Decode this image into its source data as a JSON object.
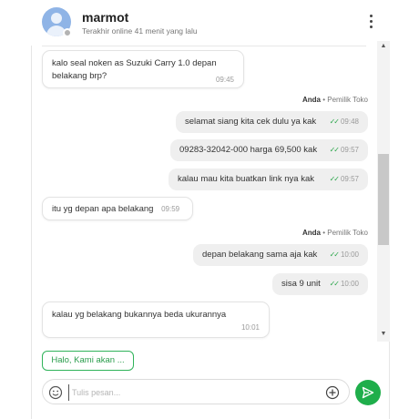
{
  "header": {
    "name": "marmot",
    "last_seen": "Terakhir online 41 menit yang lalu"
  },
  "messages": [
    {
      "direction": "in",
      "text_line1": "kalo seal noken as Suzuki Carry 1.0 depan",
      "text_line2": "belakang brp?",
      "time": "09:45"
    },
    {
      "direction": "sender",
      "sender_name": "Anda",
      "sender_role": "• Pemilik Toko"
    },
    {
      "direction": "out",
      "text": "selamat siang kita cek dulu ya kak",
      "time": "09:48",
      "ticks": "✓✓"
    },
    {
      "direction": "out",
      "text": "09283-32042-000 harga 69,500 kak",
      "time": "09:57",
      "ticks": "✓✓"
    },
    {
      "direction": "out",
      "text": "kalau mau kita buatkan link nya kak",
      "time": "09:57",
      "ticks": "✓✓"
    },
    {
      "direction": "in",
      "text": "itu yg depan apa belakang",
      "time": "09:59"
    },
    {
      "direction": "sender",
      "sender_name": "Anda",
      "sender_role": "• Pemilik Toko"
    },
    {
      "direction": "out",
      "text": "depan belakang sama aja kak",
      "time": "10:00",
      "ticks": "✓✓"
    },
    {
      "direction": "out",
      "text": "sisa 9 unit",
      "time": "10:00",
      "ticks": "✓✓"
    },
    {
      "direction": "in",
      "text": "kalau yg belakang bukannya beda ukurannya",
      "time": "10:01"
    }
  ],
  "quick_reply": {
    "label": "Halo, Kami akan ..."
  },
  "composer": {
    "placeholder": "Tulis pesan..."
  },
  "icons": {
    "menu": "more-vertical-icon",
    "emoji": "smiley-icon",
    "attach": "plus-circle-icon",
    "send": "send-arrow-icon"
  },
  "colors": {
    "accent": "#1fae4b",
    "tick": "#2aa64a",
    "out_bubble": "#efefef"
  }
}
